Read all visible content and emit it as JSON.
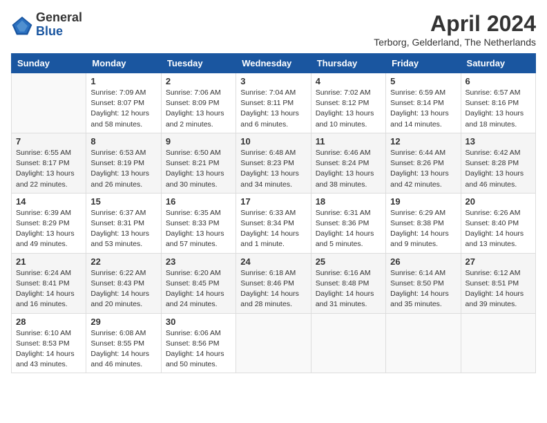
{
  "header": {
    "logo_general": "General",
    "logo_blue": "Blue",
    "month_year": "April 2024",
    "location": "Terborg, Gelderland, The Netherlands"
  },
  "weekdays": [
    "Sunday",
    "Monday",
    "Tuesday",
    "Wednesday",
    "Thursday",
    "Friday",
    "Saturday"
  ],
  "weeks": [
    [
      {
        "day": "",
        "sunrise": "",
        "sunset": "",
        "daylight": ""
      },
      {
        "day": "1",
        "sunrise": "Sunrise: 7:09 AM",
        "sunset": "Sunset: 8:07 PM",
        "daylight": "Daylight: 12 hours and 58 minutes."
      },
      {
        "day": "2",
        "sunrise": "Sunrise: 7:06 AM",
        "sunset": "Sunset: 8:09 PM",
        "daylight": "Daylight: 13 hours and 2 minutes."
      },
      {
        "day": "3",
        "sunrise": "Sunrise: 7:04 AM",
        "sunset": "Sunset: 8:11 PM",
        "daylight": "Daylight: 13 hours and 6 minutes."
      },
      {
        "day": "4",
        "sunrise": "Sunrise: 7:02 AM",
        "sunset": "Sunset: 8:12 PM",
        "daylight": "Daylight: 13 hours and 10 minutes."
      },
      {
        "day": "5",
        "sunrise": "Sunrise: 6:59 AM",
        "sunset": "Sunset: 8:14 PM",
        "daylight": "Daylight: 13 hours and 14 minutes."
      },
      {
        "day": "6",
        "sunrise": "Sunrise: 6:57 AM",
        "sunset": "Sunset: 8:16 PM",
        "daylight": "Daylight: 13 hours and 18 minutes."
      }
    ],
    [
      {
        "day": "7",
        "sunrise": "Sunrise: 6:55 AM",
        "sunset": "Sunset: 8:17 PM",
        "daylight": "Daylight: 13 hours and 22 minutes."
      },
      {
        "day": "8",
        "sunrise": "Sunrise: 6:53 AM",
        "sunset": "Sunset: 8:19 PM",
        "daylight": "Daylight: 13 hours and 26 minutes."
      },
      {
        "day": "9",
        "sunrise": "Sunrise: 6:50 AM",
        "sunset": "Sunset: 8:21 PM",
        "daylight": "Daylight: 13 hours and 30 minutes."
      },
      {
        "day": "10",
        "sunrise": "Sunrise: 6:48 AM",
        "sunset": "Sunset: 8:23 PM",
        "daylight": "Daylight: 13 hours and 34 minutes."
      },
      {
        "day": "11",
        "sunrise": "Sunrise: 6:46 AM",
        "sunset": "Sunset: 8:24 PM",
        "daylight": "Daylight: 13 hours and 38 minutes."
      },
      {
        "day": "12",
        "sunrise": "Sunrise: 6:44 AM",
        "sunset": "Sunset: 8:26 PM",
        "daylight": "Daylight: 13 hours and 42 minutes."
      },
      {
        "day": "13",
        "sunrise": "Sunrise: 6:42 AM",
        "sunset": "Sunset: 8:28 PM",
        "daylight": "Daylight: 13 hours and 46 minutes."
      }
    ],
    [
      {
        "day": "14",
        "sunrise": "Sunrise: 6:39 AM",
        "sunset": "Sunset: 8:29 PM",
        "daylight": "Daylight: 13 hours and 49 minutes."
      },
      {
        "day": "15",
        "sunrise": "Sunrise: 6:37 AM",
        "sunset": "Sunset: 8:31 PM",
        "daylight": "Daylight: 13 hours and 53 minutes."
      },
      {
        "day": "16",
        "sunrise": "Sunrise: 6:35 AM",
        "sunset": "Sunset: 8:33 PM",
        "daylight": "Daylight: 13 hours and 57 minutes."
      },
      {
        "day": "17",
        "sunrise": "Sunrise: 6:33 AM",
        "sunset": "Sunset: 8:34 PM",
        "daylight": "Daylight: 14 hours and 1 minute."
      },
      {
        "day": "18",
        "sunrise": "Sunrise: 6:31 AM",
        "sunset": "Sunset: 8:36 PM",
        "daylight": "Daylight: 14 hours and 5 minutes."
      },
      {
        "day": "19",
        "sunrise": "Sunrise: 6:29 AM",
        "sunset": "Sunset: 8:38 PM",
        "daylight": "Daylight: 14 hours and 9 minutes."
      },
      {
        "day": "20",
        "sunrise": "Sunrise: 6:26 AM",
        "sunset": "Sunset: 8:40 PM",
        "daylight": "Daylight: 14 hours and 13 minutes."
      }
    ],
    [
      {
        "day": "21",
        "sunrise": "Sunrise: 6:24 AM",
        "sunset": "Sunset: 8:41 PM",
        "daylight": "Daylight: 14 hours and 16 minutes."
      },
      {
        "day": "22",
        "sunrise": "Sunrise: 6:22 AM",
        "sunset": "Sunset: 8:43 PM",
        "daylight": "Daylight: 14 hours and 20 minutes."
      },
      {
        "day": "23",
        "sunrise": "Sunrise: 6:20 AM",
        "sunset": "Sunset: 8:45 PM",
        "daylight": "Daylight: 14 hours and 24 minutes."
      },
      {
        "day": "24",
        "sunrise": "Sunrise: 6:18 AM",
        "sunset": "Sunset: 8:46 PM",
        "daylight": "Daylight: 14 hours and 28 minutes."
      },
      {
        "day": "25",
        "sunrise": "Sunrise: 6:16 AM",
        "sunset": "Sunset: 8:48 PM",
        "daylight": "Daylight: 14 hours and 31 minutes."
      },
      {
        "day": "26",
        "sunrise": "Sunrise: 6:14 AM",
        "sunset": "Sunset: 8:50 PM",
        "daylight": "Daylight: 14 hours and 35 minutes."
      },
      {
        "day": "27",
        "sunrise": "Sunrise: 6:12 AM",
        "sunset": "Sunset: 8:51 PM",
        "daylight": "Daylight: 14 hours and 39 minutes."
      }
    ],
    [
      {
        "day": "28",
        "sunrise": "Sunrise: 6:10 AM",
        "sunset": "Sunset: 8:53 PM",
        "daylight": "Daylight: 14 hours and 43 minutes."
      },
      {
        "day": "29",
        "sunrise": "Sunrise: 6:08 AM",
        "sunset": "Sunset: 8:55 PM",
        "daylight": "Daylight: 14 hours and 46 minutes."
      },
      {
        "day": "30",
        "sunrise": "Sunrise: 6:06 AM",
        "sunset": "Sunset: 8:56 PM",
        "daylight": "Daylight: 14 hours and 50 minutes."
      },
      {
        "day": "",
        "sunrise": "",
        "sunset": "",
        "daylight": ""
      },
      {
        "day": "",
        "sunrise": "",
        "sunset": "",
        "daylight": ""
      },
      {
        "day": "",
        "sunrise": "",
        "sunset": "",
        "daylight": ""
      },
      {
        "day": "",
        "sunrise": "",
        "sunset": "",
        "daylight": ""
      }
    ]
  ]
}
